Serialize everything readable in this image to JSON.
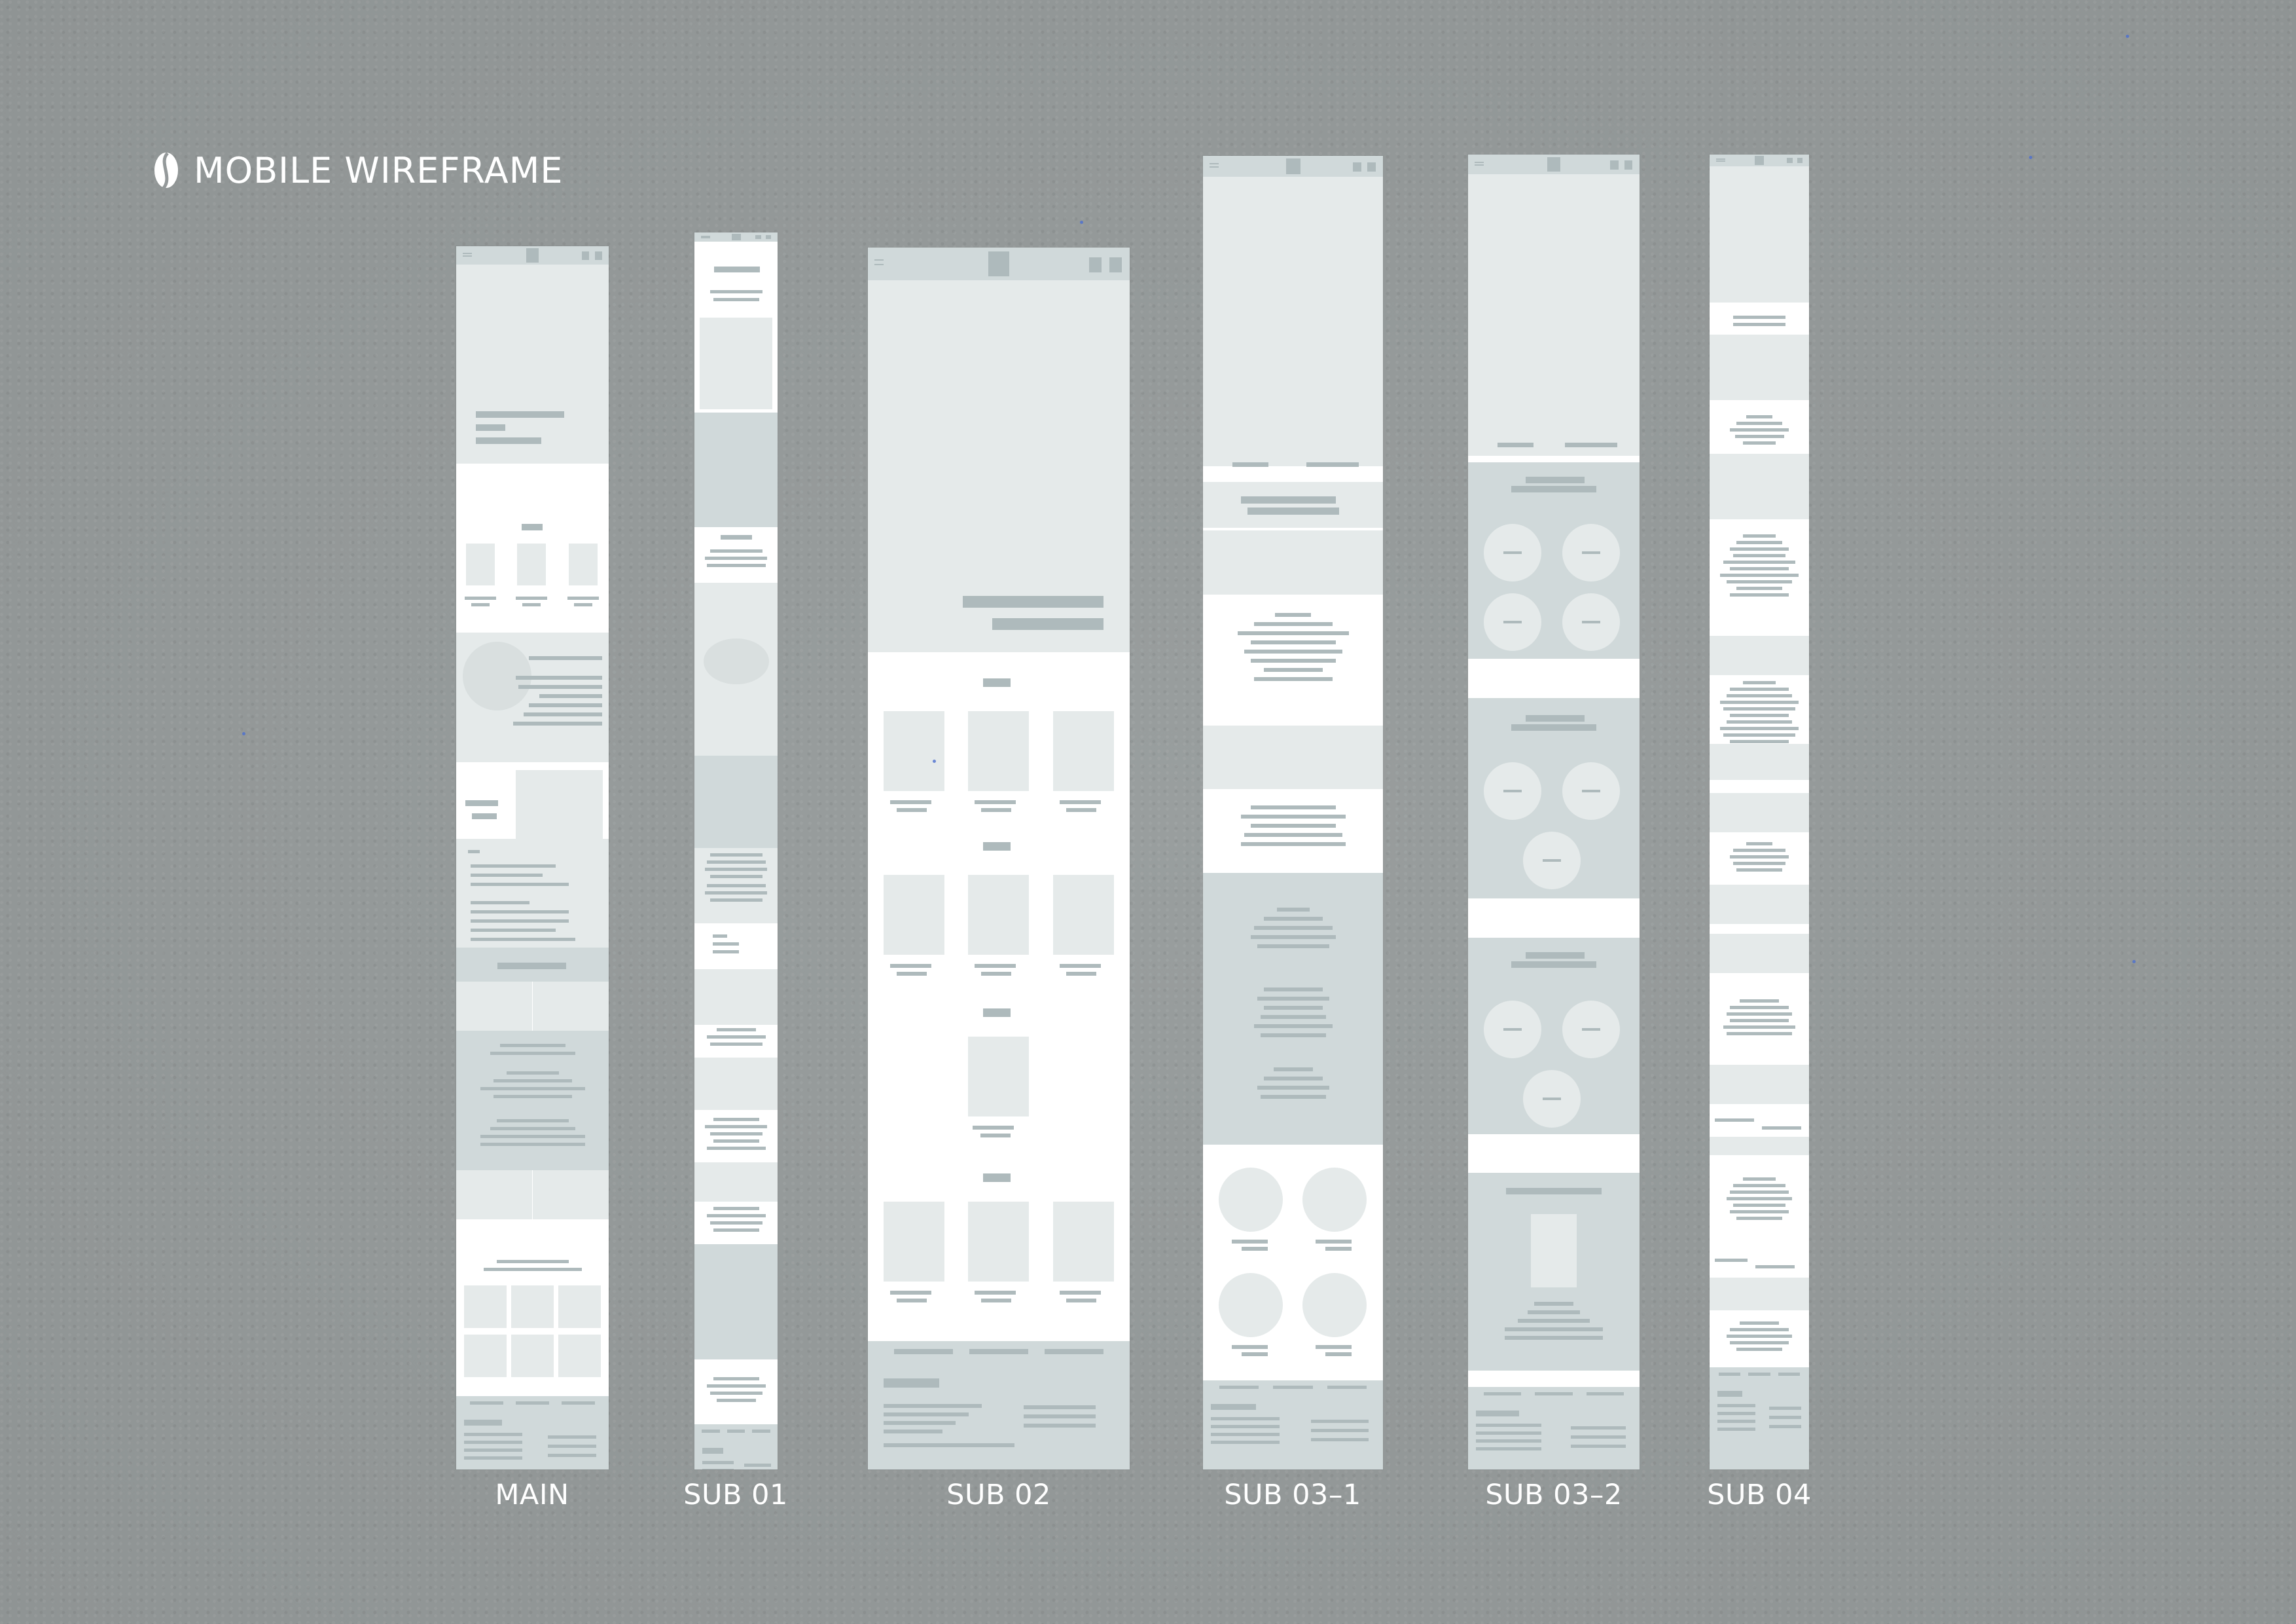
{
  "header": {
    "title": "MOBILE WIREFRAME",
    "logo_icon": "coffee-bean-icon"
  },
  "colors": {
    "background": "#94999a",
    "frame_white": "#ffffff",
    "block_light": "#e5eaea",
    "block_mid": "#d0d9da",
    "bar_dark": "#aebabc",
    "bar_text": "#a8b5b7"
  },
  "wireframes": [
    {
      "id": "main",
      "label": "MAIN"
    },
    {
      "id": "sub01",
      "label": "SUB 01"
    },
    {
      "id": "sub02",
      "label": "SUB 02"
    },
    {
      "id": "sub03-1",
      "label": "SUB 03–1"
    },
    {
      "id": "sub03-2",
      "label": "SUB 03–2"
    },
    {
      "id": "sub04",
      "label": "SUB 04"
    }
  ]
}
